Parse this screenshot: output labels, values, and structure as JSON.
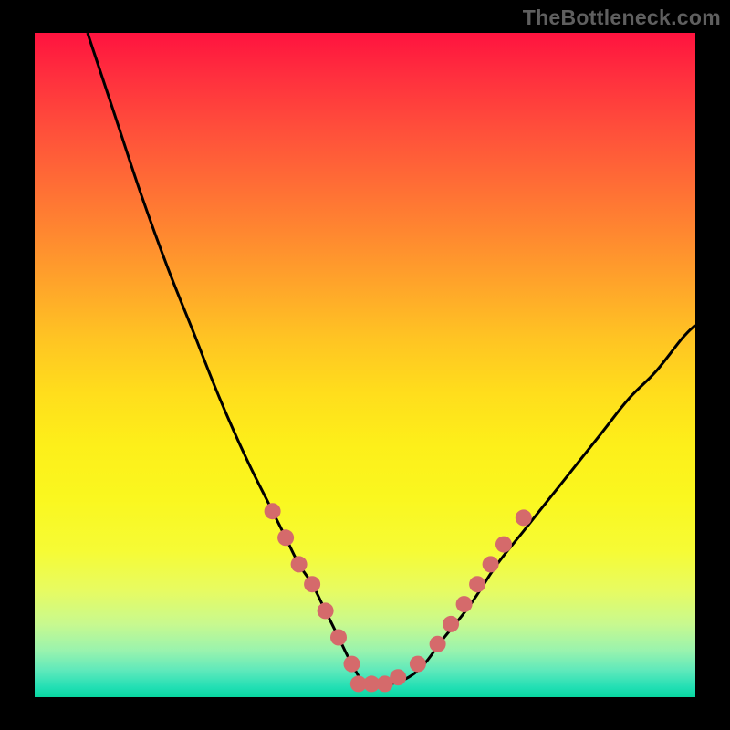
{
  "watermark": "TheBottleneck.com",
  "colors": {
    "background": "#000000",
    "curve_stroke": "#000000",
    "marker_fill": "#d56a6b",
    "watermark_text": "#5f5f5f"
  },
  "chart_data": {
    "type": "line",
    "title": "",
    "xlabel": "",
    "ylabel": "",
    "xlim": [
      0,
      100
    ],
    "ylim": [
      0,
      100
    ],
    "grid": false,
    "legend": false,
    "series": [
      {
        "name": "bottleneck-curve",
        "x": [
          8,
          12,
          16,
          20,
          24,
          28,
          32,
          36,
          38,
          40,
          42,
          44,
          46,
          48,
          50,
          52,
          54,
          58,
          62,
          66,
          70,
          74,
          78,
          82,
          86,
          90,
          94,
          98,
          100
        ],
        "y": [
          100,
          88,
          76,
          65,
          55,
          45,
          36,
          28,
          24,
          20,
          17,
          13,
          9,
          5,
          2,
          2,
          2,
          4,
          9,
          14,
          20,
          25,
          30,
          35,
          40,
          45,
          49,
          54,
          56
        ]
      }
    ],
    "markers": {
      "name": "highlighted-points",
      "points": [
        {
          "x": 36,
          "y": 28
        },
        {
          "x": 38,
          "y": 24
        },
        {
          "x": 40,
          "y": 20
        },
        {
          "x": 42,
          "y": 17
        },
        {
          "x": 44,
          "y": 13
        },
        {
          "x": 46,
          "y": 9
        },
        {
          "x": 48,
          "y": 5
        },
        {
          "x": 49,
          "y": 2
        },
        {
          "x": 51,
          "y": 2
        },
        {
          "x": 53,
          "y": 2
        },
        {
          "x": 55,
          "y": 3
        },
        {
          "x": 58,
          "y": 5
        },
        {
          "x": 61,
          "y": 8
        },
        {
          "x": 63,
          "y": 11
        },
        {
          "x": 65,
          "y": 14
        },
        {
          "x": 67,
          "y": 17
        },
        {
          "x": 69,
          "y": 20
        },
        {
          "x": 71,
          "y": 23
        },
        {
          "x": 74,
          "y": 27
        }
      ]
    },
    "annotations": []
  }
}
